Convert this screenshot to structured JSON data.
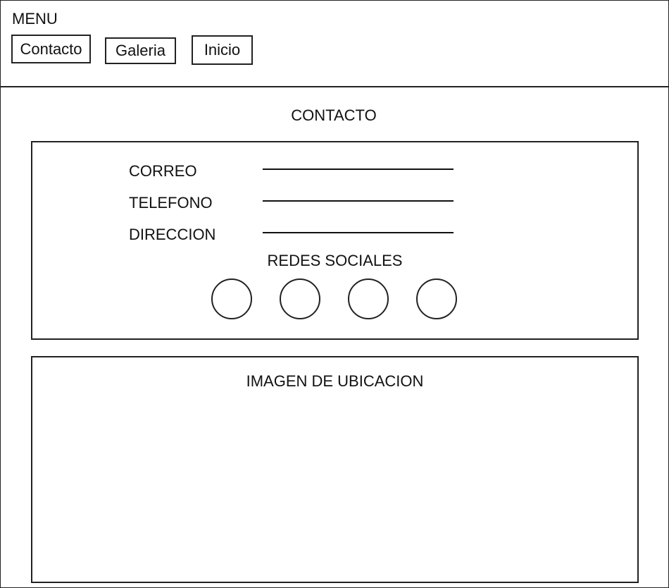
{
  "header": {
    "menu_title": "MENU",
    "nav": {
      "contacto": "Contacto",
      "galeria": "Galeria",
      "inicio": "Inicio"
    }
  },
  "main": {
    "title": "CONTACTO",
    "contact_box": {
      "fields": {
        "correo": "CORREO",
        "telefono": "TELEFONO",
        "direccion": "DIRECCION"
      },
      "social": {
        "title": "REDES SOCIALES",
        "icons": [
          "circle-placeholder-icon",
          "circle-placeholder-icon",
          "circle-placeholder-icon",
          "circle-placeholder-icon"
        ]
      }
    },
    "map_box": {
      "title": "IMAGEN DE UBICACION"
    }
  }
}
